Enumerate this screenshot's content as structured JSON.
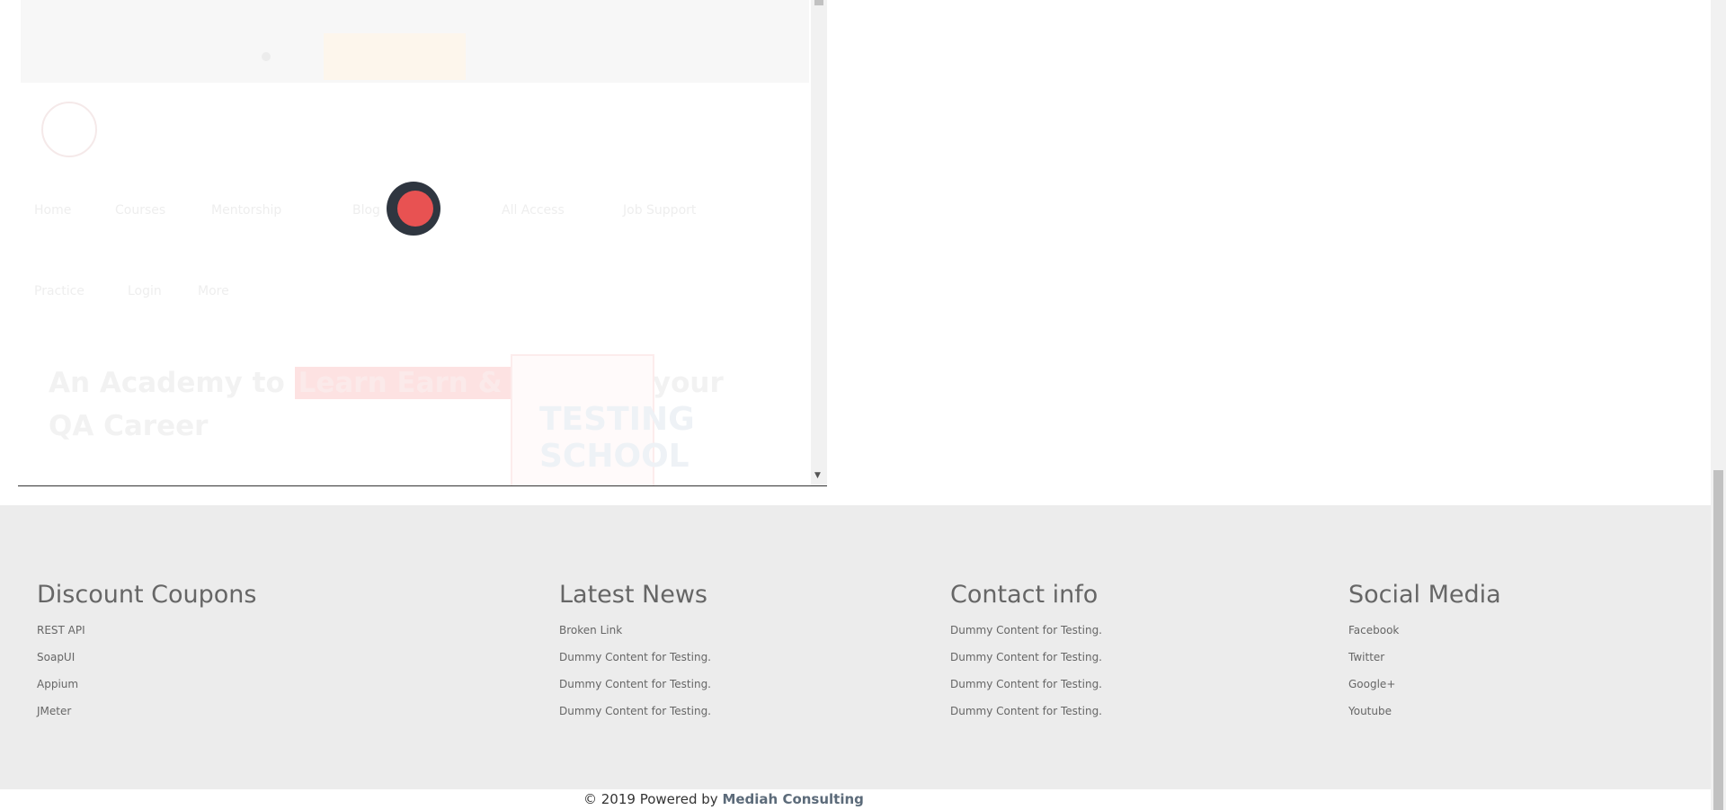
{
  "iframe": {
    "topbar_text": "",
    "topbar_button": "",
    "nav_row1": [
      "Home",
      "Courses",
      "Mentorship",
      "Blog",
      "All Access",
      "Job Support"
    ],
    "nav_row2": [
      "Practice",
      "Login",
      "More"
    ],
    "hero_title_pre": "An Academy to",
    "hero_highlight": "Learn Earn & Shine",
    "hero_title_post": "in your QA Career",
    "hero_image_text": "TESTING SCHOOL"
  },
  "footer": {
    "columns": [
      {
        "title": "Discount Coupons",
        "links": [
          "REST API",
          "SoapUI",
          "Appium",
          "JMeter"
        ]
      },
      {
        "title": "Latest News",
        "links": [
          "Broken Link",
          "Dummy Content for Testing.",
          "Dummy Content for Testing.",
          "Dummy Content for Testing."
        ]
      },
      {
        "title": "Contact info",
        "links": [
          "Dummy Content for Testing.",
          "Dummy Content for Testing.",
          "Dummy Content for Testing.",
          "Dummy Content for Testing."
        ]
      },
      {
        "title": "Social Media",
        "links": [
          "Facebook",
          "Twitter",
          "Google+",
          "Youtube"
        ]
      }
    ],
    "copyright_prefix": "© 2019 Powered by",
    "copyright_brand": "Mediah Consulting"
  },
  "colors": {
    "loader_dark": "#2f3640",
    "loader_accent": "#e85252",
    "footer_bg": "#ececec"
  },
  "icons": [
    "loader-icon",
    "logo-icon",
    "chevron-down-icon"
  ]
}
